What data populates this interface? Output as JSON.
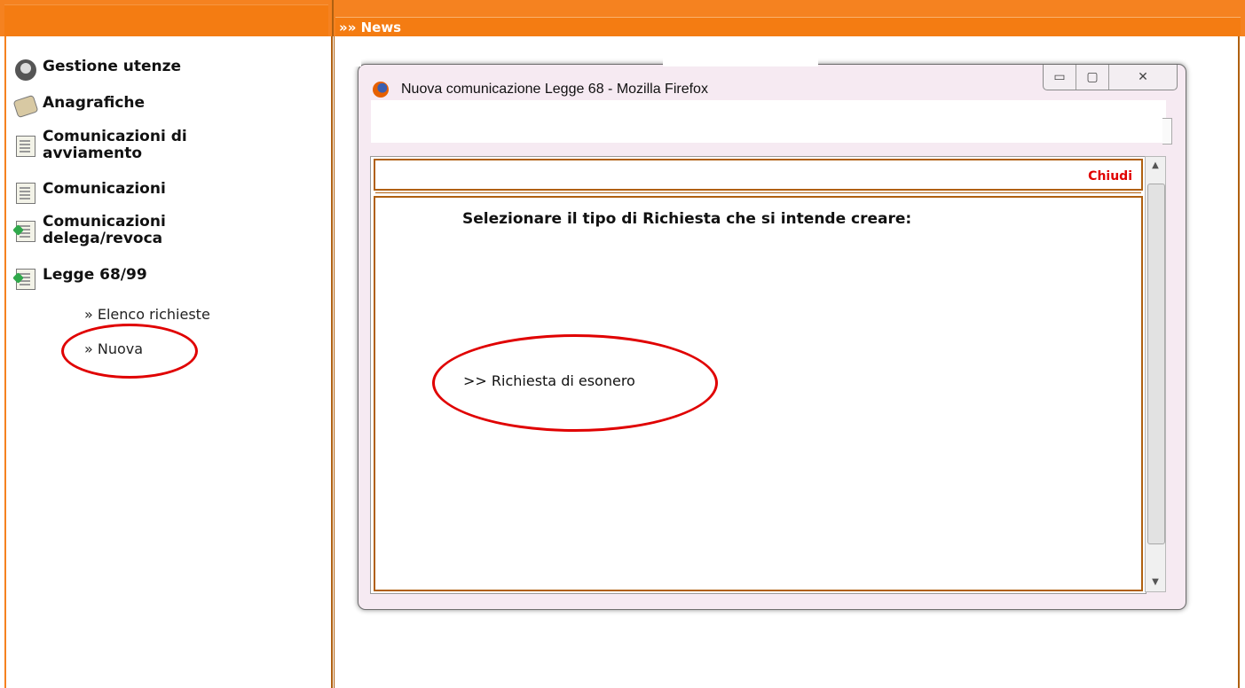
{
  "header": {
    "left_text": "",
    "news_title": "»» News"
  },
  "sidebar": {
    "items": [
      {
        "label": "Gestione utenze",
        "icon": "people-icon"
      },
      {
        "label": "Anagrafiche",
        "icon": "book-icon"
      },
      {
        "label": "Comunicazioni di avviamento",
        "icon": "document-icon"
      },
      {
        "label": "Comunicazioni",
        "icon": "document-icon"
      },
      {
        "label": "Comunicazioni delega/revoca",
        "icon": "document-green-icon"
      },
      {
        "label": "Legge 68/99",
        "icon": "document-green-icon"
      }
    ],
    "sub_items": [
      {
        "label": "» Elenco richieste"
      },
      {
        "label": "» Nuova"
      }
    ]
  },
  "popup": {
    "title": "Nuova comunicazione Legge 68 - Mozilla Firefox",
    "minimize_label": "▭",
    "maximize_label": "▢",
    "close_label": "✕",
    "close_link": "Chiudi",
    "heading": "Selezionare il tipo di Richiesta che si intende creare:",
    "option_link": ">> Richiesta di esonero"
  },
  "colors": {
    "accent": "#f58220",
    "border": "#b06010",
    "highlight": "#e00000"
  }
}
